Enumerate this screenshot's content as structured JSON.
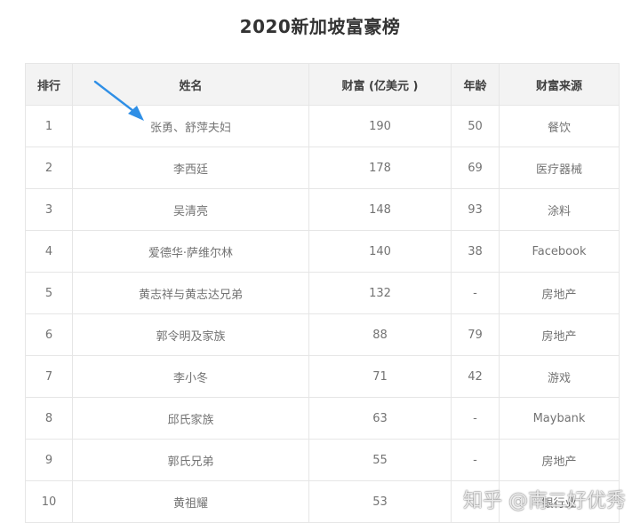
{
  "title": "2020新加坡富豪榜",
  "table": {
    "headers": [
      "排行",
      "姓名",
      "财富 (亿美元 )",
      "年龄",
      "财富来源"
    ],
    "rows": [
      [
        "1",
        "张勇、舒萍夫妇",
        "190",
        "50",
        "餐饮"
      ],
      [
        "2",
        "李西廷",
        "178",
        "69",
        "医疗器械"
      ],
      [
        "3",
        "吴清亮",
        "148",
        "93",
        "涂料"
      ],
      [
        "4",
        "爱德华·萨维尔林",
        "140",
        "38",
        "Facebook"
      ],
      [
        "5",
        "黄志祥与黄志达兄弟",
        "132",
        "-",
        "房地产"
      ],
      [
        "6",
        "郭令明及家族",
        "88",
        "79",
        "房地产"
      ],
      [
        "7",
        "李小冬",
        "71",
        "42",
        "游戏"
      ],
      [
        "8",
        "邱氏家族",
        "63",
        "-",
        "Maybank"
      ],
      [
        "9",
        "郭氏兄弟",
        "55",
        "-",
        "房地产"
      ],
      [
        "10",
        "黄祖耀",
        "53",
        "",
        "银行业"
      ]
    ]
  },
  "watermark": "知乎 @南二好优秀",
  "colors": {
    "arrow": "#2f8fe6",
    "header_bg": "#f3f3f3",
    "border": "#e6e6e6"
  }
}
